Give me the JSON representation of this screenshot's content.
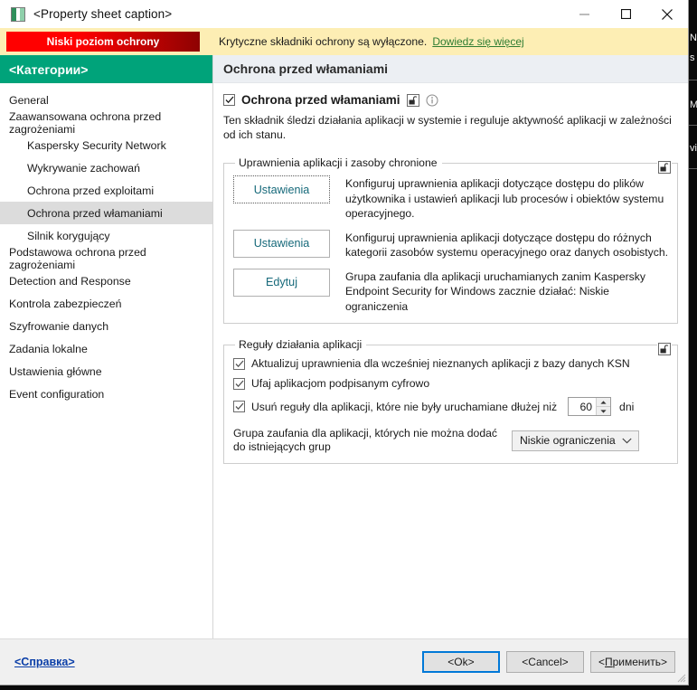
{
  "window": {
    "title": "<Property sheet caption>",
    "icon": "app-icon",
    "controls": {
      "minimize": "minimize-icon",
      "maximize": "maximize-icon",
      "close": "close-icon"
    }
  },
  "banner": {
    "badge_label": "Niski poziom ochrony",
    "message": "Krytyczne składniki ochrony są wyłączone.",
    "link_label": "Dowiedz się więcej",
    "background": "#fdeeb4",
    "badge_color_start": "#ff0000",
    "badge_color_end": "#8e0202",
    "link_color": "#2f7d32"
  },
  "sidebar": {
    "header": "<Категории>",
    "header_color": "#00a37a",
    "items": [
      {
        "label": "General",
        "level": 0,
        "selected": false
      },
      {
        "label": "Zaawansowana ochrona przed zagrożeniami",
        "level": 0,
        "selected": false
      },
      {
        "label": "Kaspersky Security Network",
        "level": 1,
        "selected": false
      },
      {
        "label": "Wykrywanie zachowań",
        "level": 1,
        "selected": false
      },
      {
        "label": "Ochrona przed exploitami",
        "level": 1,
        "selected": false
      },
      {
        "label": "Ochrona przed włamaniami",
        "level": 1,
        "selected": true
      },
      {
        "label": "Silnik korygujący",
        "level": 1,
        "selected": false
      },
      {
        "label": "Podstawowa ochrona przed zagrożeniami",
        "level": 0,
        "selected": false
      },
      {
        "label": "Detection and Response",
        "level": 0,
        "selected": false
      },
      {
        "label": "Kontrola zabezpieczeń",
        "level": 0,
        "selected": false
      },
      {
        "label": "Szyfrowanie danych",
        "level": 0,
        "selected": false
      },
      {
        "label": "Zadania lokalne",
        "level": 0,
        "selected": false
      },
      {
        "label": "Ustawienia główne",
        "level": 0,
        "selected": false
      },
      {
        "label": "Event configuration",
        "level": 0,
        "selected": false
      }
    ]
  },
  "content": {
    "header_title": "Ochrona przed włamaniami",
    "enable_checkbox": {
      "label": "Ochrona przed włamaniami",
      "checked": true
    },
    "description": "Ten składnik śledzi działania aplikacji w systemie i reguluje aktywność aplikacji w zależności od ich stanu.",
    "permissions_group": {
      "legend": "Uprawnienia aplikacji i zasoby chronione",
      "rows": [
        {
          "button": "Ustawienia",
          "description": "Konfiguruj uprawnienia aplikacji dotyczące dostępu do plików użytkownika i ustawień aplikacji lub procesów i obiektów systemu operacyjnego."
        },
        {
          "button": "Ustawienia",
          "description": "Konfiguruj uprawnienia aplikacji dotyczące dostępu do różnych kategorii zasobów systemu operacyjnego oraz danych osobistych."
        },
        {
          "button": "Edytuj",
          "description": "Grupa zaufania dla aplikacji uruchamianych zanim Kaspersky Endpoint Security for Windows zacznie działać: Niskie ograniczenia"
        }
      ]
    },
    "rules_group": {
      "legend": "Reguły działania aplikacji",
      "checkboxes": [
        {
          "label": "Aktualizuj uprawnienia dla wcześniej nieznanych aplikacji z bazy danych KSN",
          "checked": true
        },
        {
          "label": "Ufaj aplikacjom podpisanym cyfrowo",
          "checked": true
        },
        {
          "label": "Usuń reguły dla aplikacji, które nie były uruchamiane dłużej niż",
          "checked": true
        }
      ],
      "spinner_value": "60",
      "spinner_unit": "dni",
      "trust_label": "Grupa zaufania dla aplikacji, których nie można dodać do istniejących grup",
      "trust_value": "Niskie ograniczenia"
    }
  },
  "footer": {
    "help_label": "<Справка>",
    "ok_label": "<Ok>",
    "cancel_label": "<Cancel>",
    "apply_label_pre": "<",
    "apply_label_mnemonic": "П",
    "apply_label_post": "рименить>"
  },
  "right_strip": {
    "lines": [
      "N",
      "s",
      "Ma",
      "vi"
    ]
  }
}
